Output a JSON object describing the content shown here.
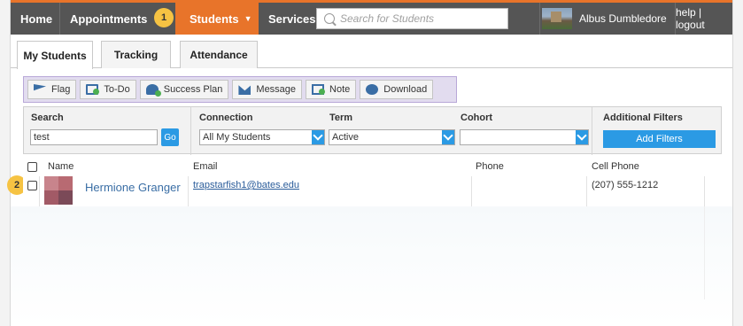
{
  "navbar": {
    "home": "Home",
    "appointments": "Appointments",
    "students": "Students",
    "services": "Services",
    "search_placeholder": "Search for Students",
    "user_name": "Albus Dumbledore",
    "help_logout": "help | logout"
  },
  "callouts": {
    "one": "1",
    "two": "2"
  },
  "tabs": [
    {
      "label": "My Students",
      "active": true
    },
    {
      "label": "Tracking",
      "active": false
    },
    {
      "label": "Attendance",
      "active": false
    }
  ],
  "toolbar": {
    "flag": "Flag",
    "todo": "To-Do",
    "success_plan": "Success Plan",
    "message": "Message",
    "note": "Note",
    "download": "Download"
  },
  "filters": {
    "search_label": "Search",
    "search_value": "test",
    "go_label": "Go",
    "connection_label": "Connection",
    "connection_value": "All My Students",
    "term_label": "Term",
    "term_value": "Active",
    "cohort_label": "Cohort",
    "cohort_value": "",
    "additional_label": "Additional Filters",
    "add_filters_button": "Add Filters"
  },
  "table": {
    "headers": {
      "name": "Name",
      "email": "Email",
      "phone": "Phone",
      "cell_phone": "Cell Phone"
    },
    "rows": [
      {
        "name": "Hermione Granger",
        "email": "trapstarfish1@bates.edu",
        "phone": "",
        "cell_phone": "(207) 555-1212"
      }
    ]
  },
  "colors": {
    "nav_bg": "#555555",
    "accent_orange": "#e8742a",
    "accent_blue": "#2b9ae4",
    "toolbar_purple": "#e2dcef",
    "callout_yellow": "#f6c343"
  }
}
